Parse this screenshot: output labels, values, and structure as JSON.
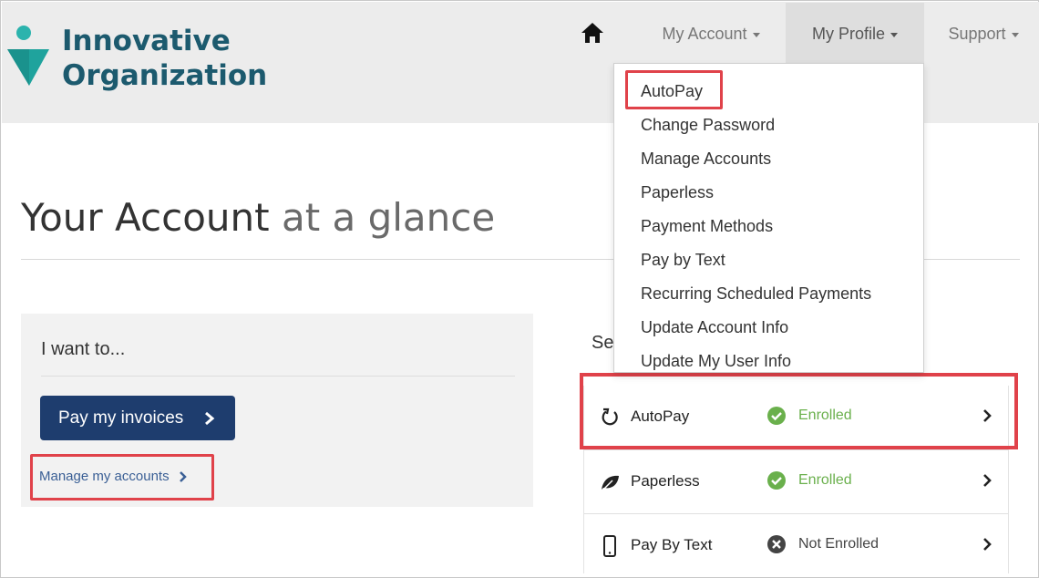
{
  "brand": {
    "line1": "Innovative",
    "line2": "Organization",
    "mark_colors": {
      "dot": "#2bb3ad",
      "arrow": "#1fa39d"
    }
  },
  "nav": {
    "home_icon": "home-icon",
    "items": [
      {
        "label": "My Account"
      },
      {
        "label": "My Profile",
        "active": true
      },
      {
        "label": "Support"
      }
    ]
  },
  "page": {
    "title_main": "Your Account",
    "title_light": "at a glance"
  },
  "quick_actions": {
    "heading": "I want to...",
    "pay_button": "Pay my invoices",
    "manage_link": "Manage my accounts"
  },
  "services": {
    "heading_fragment": "Se",
    "rows": [
      {
        "label": "AutoPay",
        "icon": "refresh-icon",
        "status": "Enrolled",
        "status_icon": "check-circle-icon",
        "status_color": "#6ab04c"
      },
      {
        "label": "Paperless",
        "icon": "leaf-icon",
        "status": "Enrolled",
        "status_icon": "check-circle-icon",
        "status_color": "#6ab04c"
      },
      {
        "label": "Pay By Text",
        "icon": "phone-icon",
        "status": "Not Enrolled",
        "status_icon": "x-circle-icon",
        "status_color": "#444444"
      }
    ]
  },
  "profile_menu": {
    "items": [
      "AutoPay",
      "Change Password",
      "Manage Accounts",
      "Paperless",
      "Payment Methods",
      "Pay by Text",
      "Recurring Scheduled Payments",
      "Update Account Info",
      "Update My User Info"
    ]
  },
  "colors": {
    "header_bg": "#ececec",
    "brand_text": "#1c5a6e",
    "primary_button": "#1e3d6e",
    "highlight": "#e0424a",
    "link": "#3a5f95"
  }
}
